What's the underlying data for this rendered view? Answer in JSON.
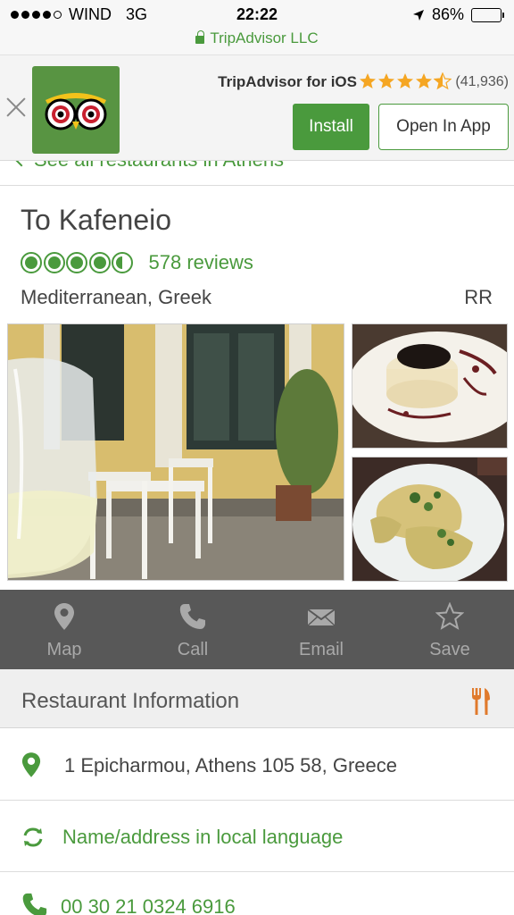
{
  "status_bar": {
    "carrier": "WIND",
    "network": "3G",
    "time": "22:22",
    "battery": "86%",
    "battery_level": 0.86,
    "url": "TripAdvisor LLC"
  },
  "app_banner": {
    "title": "TripAdvisor for iOS",
    "rating": 4.5,
    "rating_count": "(41,936)",
    "install_label": "Install",
    "open_label": "Open In App"
  },
  "back_link": "See all restaurants in Athens",
  "restaurant": {
    "name": "To Kafeneio",
    "rating": 4.5,
    "reviews": "578 reviews",
    "cuisine": "Mediterranean, Greek",
    "price": "RR"
  },
  "actions": [
    {
      "label": "Map",
      "icon": "map-pin-icon"
    },
    {
      "label": "Call",
      "icon": "phone-icon"
    },
    {
      "label": "Email",
      "icon": "envelope-icon"
    },
    {
      "label": "Save",
      "icon": "star-outline-icon"
    }
  ],
  "info": {
    "section_title": "Restaurant Information",
    "address": "1 Epicharmou, Athens 105 58, Greece",
    "local_language": "Name/address in local language",
    "phone": "00 30 21 0324 6916"
  },
  "colors": {
    "brand_green": "#4a9a3d",
    "action_bar": "#585858",
    "accent_orange": "#e07a2c",
    "star_orange": "#f5a623"
  }
}
